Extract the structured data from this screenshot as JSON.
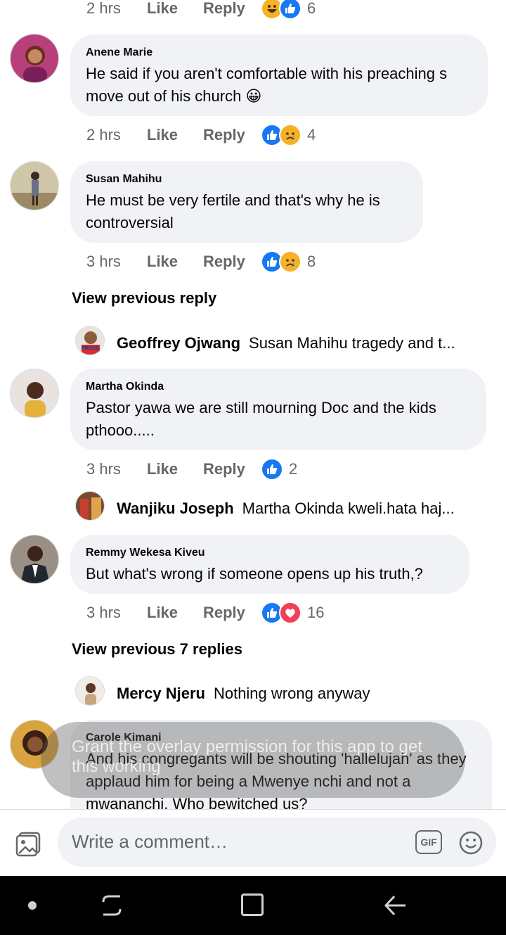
{
  "top_partial": {
    "time": "2 hrs",
    "like": "Like",
    "reply": "Reply",
    "count": "6"
  },
  "comments": [
    {
      "author": "Anene Marie",
      "text": "He said if you aren't comfortable with his preaching s move out of his church 😀",
      "time": "2 hrs",
      "like": "Like",
      "reply": "Reply",
      "count": "4"
    },
    {
      "author": "Susan Mahihu",
      "text": "He must be very fertile and that's why he is controversial",
      "time": "3 hrs",
      "like": "Like",
      "reply": "Reply",
      "count": "8"
    },
    {
      "author": "Martha Okinda",
      "text": "Pastor yawa we are still mourning Doc and the kids pthooo.....",
      "time": "3 hrs",
      "like": "Like",
      "reply": "Reply",
      "count": "2"
    },
    {
      "author": "Remmy Wekesa Kiveu",
      "text": "But what's wrong if someone opens up his truth,?",
      "time": "3 hrs",
      "like": "Like",
      "reply": "Reply",
      "count": "16"
    },
    {
      "author": "Carole Kimani",
      "text": "And his congregants will be shouting 'hallelujah' as they applaud him for being a Mwenye nchi and not a mwananchi. Who bewitched us?"
    }
  ],
  "view_previous": [
    "View previous reply",
    "View previous 7 replies"
  ],
  "replies": [
    {
      "author": "Geoffrey Ojwang",
      "text": "Susan Mahihu tragedy and t..."
    },
    {
      "author": "Wanjiku Joseph",
      "text": "Martha Okinda kweli.hata haj..."
    },
    {
      "author": "Mercy Njeru",
      "text": "Nothing wrong anyway"
    }
  ],
  "avatar_badge": "PROUD",
  "toast": "Grant the overlay permission for this app to get this working",
  "composer": {
    "placeholder": "Write a comment…",
    "gif": "GIF"
  },
  "colors": {
    "accent": "#1877f2",
    "bubble": "#f0f2f5",
    "secondary_text": "#65676b",
    "love": "#f33e58",
    "haha": "#f7b125"
  }
}
